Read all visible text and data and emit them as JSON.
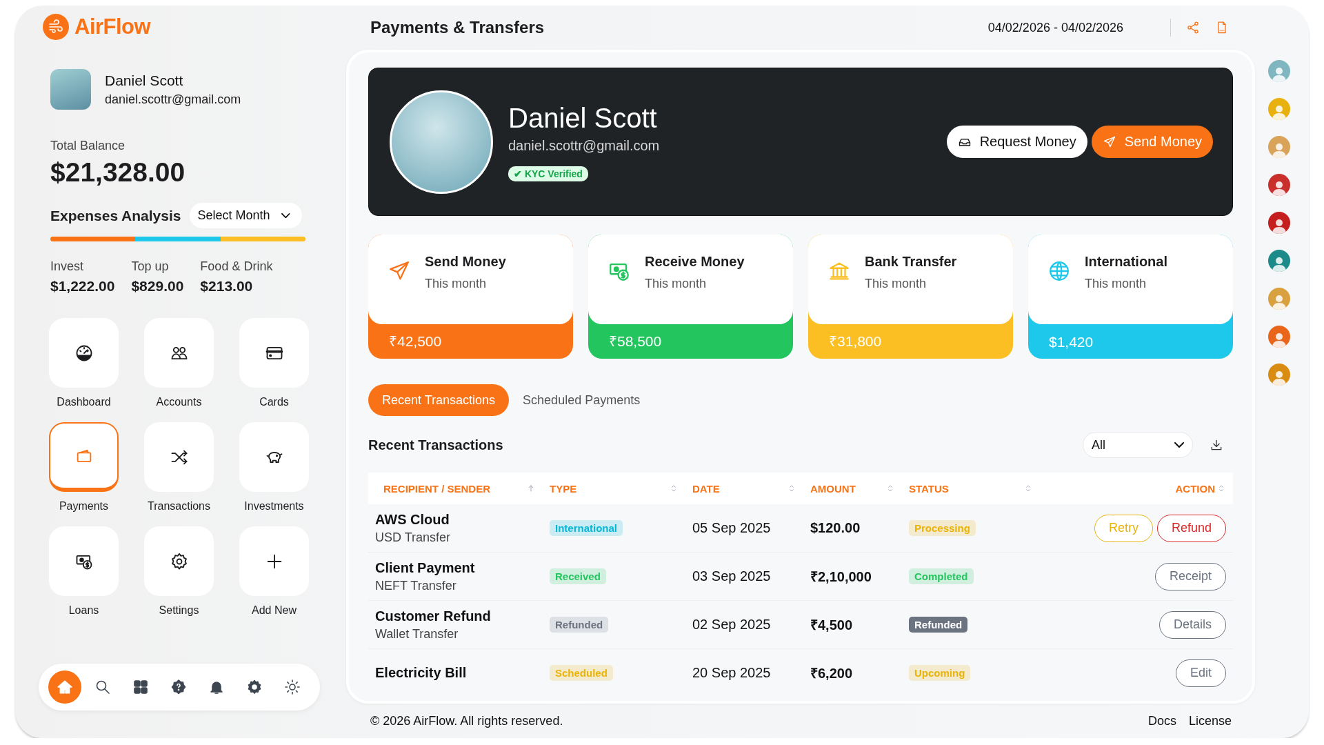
{
  "brand": {
    "name": "AirFlow"
  },
  "user": {
    "name": "Daniel Scott",
    "email": "daniel.scottr@gmail.com"
  },
  "balance": {
    "label": "Total Balance",
    "amount": "$21,328.00"
  },
  "expenses": {
    "title": "Expenses Analysis",
    "month_select": "Select Month",
    "categories": [
      {
        "label": "Invest",
        "amount": "$1,222.00",
        "color": "#f97316"
      },
      {
        "label": "Top up",
        "amount": "$829.00",
        "color": "#1ec8ea"
      },
      {
        "label": "Food & Drink",
        "amount": "$213.00",
        "color": "#fbbf24"
      }
    ]
  },
  "nav": [
    {
      "label": "Dashboard",
      "selected": false
    },
    {
      "label": "Accounts",
      "selected": false
    },
    {
      "label": "Cards",
      "selected": false
    },
    {
      "label": "Payments",
      "selected": true
    },
    {
      "label": "Transactions",
      "selected": false
    },
    {
      "label": "Investments",
      "selected": false
    },
    {
      "label": "Loans",
      "selected": false
    },
    {
      "label": "Settings",
      "selected": false
    },
    {
      "label": "Add New",
      "selected": false
    }
  ],
  "dock": [
    {
      "selected": true
    },
    {
      "selected": false
    },
    {
      "selected": false
    },
    {
      "selected": false
    },
    {
      "selected": false
    },
    {
      "selected": false
    },
    {
      "selected": false
    }
  ],
  "header": {
    "title": "Payments & Transfers",
    "date_range": "04/02/2026 - 04/02/2026"
  },
  "profile": {
    "name": "Daniel Scott",
    "email": "daniel.scottr@gmail.com",
    "badge": "✔ KYC Verified",
    "buttons": [
      {
        "label": "Request Money",
        "kind": "secondary"
      },
      {
        "label": "Send Money",
        "kind": "primary"
      }
    ]
  },
  "stats": [
    {
      "title": "Send Money",
      "subtitle": "This month",
      "amount": "₹42,500",
      "color": "#f97316"
    },
    {
      "title": "Receive Money",
      "subtitle": "This month",
      "amount": "₹58,500",
      "color": "#22c55e"
    },
    {
      "title": "Bank Transfer",
      "subtitle": "This month",
      "amount": "₹31,800",
      "color": "#fbbf24"
    },
    {
      "title": "International",
      "subtitle": "This month",
      "amount": "$1,420",
      "color": "#1ec8ea"
    }
  ],
  "tabs": [
    {
      "label": "Recent Transactions",
      "selected": true
    },
    {
      "label": "Scheduled Payments",
      "selected": false
    }
  ],
  "transactions": {
    "title": "Recent Transactions",
    "filter": "All",
    "columns": [
      {
        "label": "RECIPIENT / SENDER",
        "sorted": true
      },
      {
        "label": "TYPE",
        "sorted": false
      },
      {
        "label": "DATE",
        "sorted": false
      },
      {
        "label": "AMOUNT",
        "sorted": false
      },
      {
        "label": "STATUS",
        "sorted": false
      },
      {
        "label": "ACTION",
        "sorted": false
      }
    ],
    "rows": [
      {
        "name": "AWS Cloud",
        "method": "USD Transfer",
        "type": {
          "label": "International",
          "color": "#06b6d4",
          "filled": false
        },
        "date": "05 Sep 2025",
        "amount": "$120.00",
        "status": {
          "label": "Processing",
          "color": "#eab308",
          "filled": false
        },
        "actions": [
          {
            "label": "Retry",
            "color": "#eab308"
          },
          {
            "label": "Refund",
            "color": "#dc2626"
          }
        ]
      },
      {
        "name": "Client Payment",
        "method": "NEFT Transfer",
        "type": {
          "label": "Received",
          "color": "#22c55e",
          "filled": false
        },
        "date": "03 Sep 2025",
        "amount": "₹2,10,000",
        "status": {
          "label": "Completed",
          "color": "#22c55e",
          "filled": false
        },
        "actions": [
          {
            "label": "Receipt",
            "color": "#6b7280"
          }
        ]
      },
      {
        "name": "Customer Refund",
        "method": "Wallet Transfer",
        "type": {
          "label": "Refunded",
          "color": "#6b7280",
          "filled": false
        },
        "date": "02 Sep 2025",
        "amount": "₹4,500",
        "status": {
          "label": "Refunded",
          "color": "#6b7280",
          "filled": true
        },
        "actions": [
          {
            "label": "Details",
            "color": "#6b7280"
          }
        ]
      },
      {
        "name": "Electricity Bill",
        "type": {
          "label": "Scheduled",
          "color": "#eab308",
          "filled": false
        },
        "date": "20 Sep 2025",
        "amount": "₹6,200",
        "status": {
          "label": "Upcoming",
          "color": "#eab308",
          "filled": false
        },
        "actions": [
          {
            "label": "Edit",
            "color": "#6b7280"
          }
        ]
      }
    ]
  },
  "avatars": [
    {
      "color": "#7fb6bf"
    },
    {
      "color": "#e9b10f"
    },
    {
      "color": "#d9a35a"
    },
    {
      "color": "#c9302c"
    },
    {
      "color": "#c41e1e"
    },
    {
      "color": "#1d8a8a"
    },
    {
      "color": "#d9a040"
    },
    {
      "color": "#e8651a"
    },
    {
      "color": "#d98c12"
    }
  ],
  "footer": {
    "copyright": "© 2026 AirFlow. All rights reserved.",
    "links": [
      "Docs",
      "License"
    ]
  }
}
